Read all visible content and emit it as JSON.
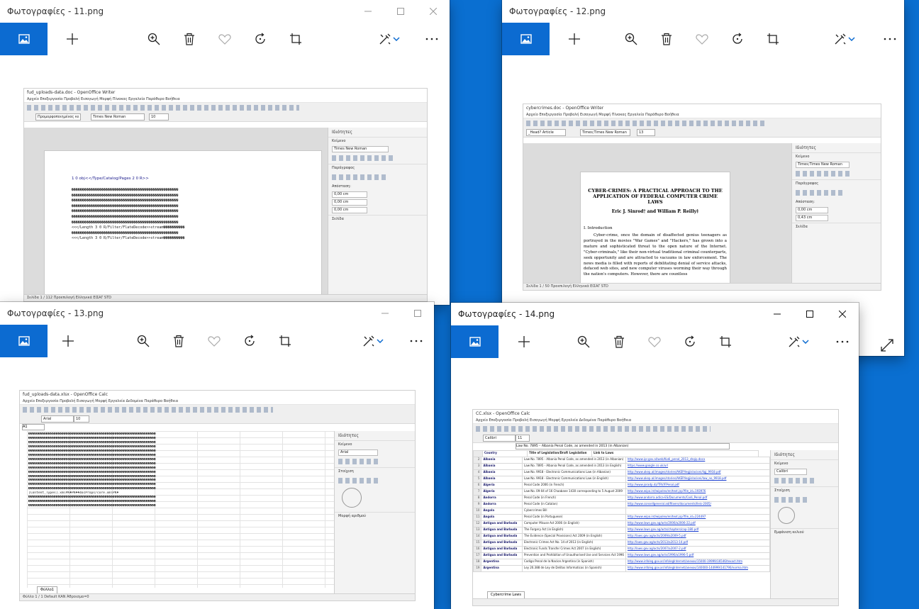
{
  "colors": {
    "desktop": "#0a6fd1",
    "accent": "#0c6bd1"
  },
  "toolbar_icons": [
    "image-icon",
    "add-icon",
    "zoom-icon",
    "delete-icon",
    "favorite-icon",
    "rotate-icon",
    "crop-icon",
    "edit-icon",
    "more-icon"
  ],
  "win11": {
    "title": "Φωτογραφίες - 11.png",
    "doc": {
      "app_title": "fud_uploads-data.doc - OpenOffice Writer",
      "menu": "Αρχείο  Επεξεργασία  Προβολή  Εισαγωγή  Μορφή  Πίνακας  Εργαλεία  Παράθυρο  Βοήθεια",
      "style": "Προμορφοποιημένος κε",
      "font": "Times New Roman",
      "size": "10",
      "sidebar_title": "Ιδιότητες",
      "sec_text": "Κείμενο",
      "sec_para": "Παράγραφος",
      "sec_page": "Σελίδα",
      "spacing": "Απόσταση:",
      "indent": "Εσοχή:",
      "val": "0,00 cm",
      "page_head": "1 0 obj<</Type/Catalog/Pages 2 0 R>>",
      "garble_line": "��������������������������������������������������",
      "garble_mix": "<<</Length 3 0 R/Filter/FlateDecode>>stream����������",
      "status": "Σελίδα 1 / 112    Προεπιλογή    Ελληνικά    ΕΙΣΑΓ    STD"
    }
  },
  "win12": {
    "title": "Φωτογραφίες - 12.png",
    "doc": {
      "app_title": "cybercrimes.doc - OpenOffice Writer",
      "menu": "Αρχείο  Επεξεργασία  Προβολή  Εισαγωγή  Μορφή  Πίνακας  Εργαλεία  Παράθυρο  Βοήθεια",
      "style": "_Head? Article",
      "font": "Times;Times New Roman",
      "size": "13",
      "sidebar_title": "Ιδιότητες",
      "sec_text": "Κείμενο",
      "sec_para": "Παράγραφος",
      "sec_page": "Σελίδα",
      "spacing": "Απόσταση:",
      "indent": "Εσοχή:",
      "val1": "0,00 cm",
      "val2": "0,43 cm",
      "paper_title": "CYBER-CRIMES: A PRACTICAL APPROACH TO THE APPLICATION OF FEDERAL COMPUTER CRIME LAWS",
      "paper_authors": "Eric J. Sinrod† and William P. Reilly‡",
      "section": "I.   Introduction",
      "body": "Cyber-crime, once the domain of disaffected genius teenagers as portrayed in the movies \"War Games\" and \"Hackers,\" has grown into a mature and sophisticated threat to the open nature of the Internet. \"Cyber-criminals,\" like their non-virtual traditional criminal counterparts, seek opportunity and are attracted to vacuums in law enforcement. The news media is filled with reports of debilitating denial of service attacks, defaced web sites, and new computer viruses worming their way through the nation's computers. However, there are countless",
      "status": "Σελίδα 1 / 50    Προεπιλογή    Ελληνικά    ΕΙΣΑΓ    STD"
    }
  },
  "win13": {
    "title": "Φωτογραφίες - 13.png",
    "doc": {
      "app_title": "fud_uploads-data.xlsx - OpenOffice Calc",
      "menu": "Αρχείο  Επεξεργασία  Προβολή  Εισαγωγή  Μορφή  Εργαλεία  Δεδομένα  Παράθυρο  Βοήθεια",
      "font": "Arial",
      "size": "10",
      "cellref": "A1",
      "sidebar_title": "Ιδιότητες",
      "sec_text": "Κείμενο",
      "sec_align": "Στοίχιση",
      "sec_num": "Μορφή αριθμού",
      "content_types": "[Content_Types].xmlPK♦PK♦♦docProps/core.xmlPK♦",
      "sheet_tab": "Φύλλο1",
      "garble_line": "�����������������������������������������������������������������",
      "status": "Φύλλο 1 / 1    Default    ΚΑΝ    Άθροισμα=0"
    }
  },
  "win14": {
    "title": "Φωτογραφίες - 14.png",
    "doc": {
      "app_title": "CC.xlsx - OpenOffice Calc",
      "menu": "Αρχείο  Επεξεργασία  Προβολή  Εισαγωγή  Μορφή  Εργαλεία  Δεδομένα  Παράθυρο  Βοήθεια",
      "font": "Calibri",
      "size": "11",
      "formula": "Law No. 7895 – Albania Penal Code, as amended in 2013 (in Albanian)",
      "sidebar_title": "Ιδιότητες",
      "sec_text": "Κείμενο",
      "sec_align": "Στοίχιση",
      "sec_cell": "Εμφάνιση κελιού",
      "col_country": "Country",
      "col_title": "Title of Legislation/Draft Legislation",
      "col_link": "Link to Laws",
      "sheet_tab": "Cybercrime Laws",
      "rows": [
        {
          "c": "Albania",
          "t": "Law No. 7895 - Albania Penal Code, as amended in 2013 (in Albanian)",
          "l": "http://www.ipr.gov.al/web/Kodi_penal_2013_shqip.docx"
        },
        {
          "c": "Albania",
          "t": "Law No. 7895 - Albania Penal Code, as amended in 2013 (in English)",
          "l": "https://www.google.co.uk/url"
        },
        {
          "c": "Albania",
          "t": "Law No. 9918 - Electronic Communications Law (in Albanian)",
          "l": "http://www.akep.al/images/stories/AKEP/legjislacioni/ligj_9918.pdf"
        },
        {
          "c": "Albania",
          "t": "Law No. 9918 - Electronic Communications Law (in English)",
          "l": "http://www.akep.al/images/stories/AKEP/legjislacioni/law_no_9918.pdf"
        },
        {
          "c": "Algeria",
          "t": "Penal Code 2006 (in French)",
          "l": "http://www.joradp.dz/TRV/FPenal.pdf"
        },
        {
          "c": "Algeria",
          "t": "Law No. 09-04 of 16 Chaabane 1430 corresponding to 5 August 2009",
          "l": "http://www.wipo.int/wipolex/en/text.jsp?file_id=193976"
        },
        {
          "c": "Andorra",
          "t": "Penal Code (in French)",
          "l": "http://www.andorra.ad/ca-ES/Documents/Codi_Penal.pdf"
        },
        {
          "c": "Andorra",
          "t": "Penal Code (in Catalan)",
          "l": "http://www.consellgeneral.ad/fitxers/documents/lleis-2005/"
        },
        {
          "c": "Angola",
          "t": "Cybercrimes Bill",
          "l": ""
        },
        {
          "c": "Angola",
          "t": "Penal Code (in Portuguese)",
          "l": "http://www.wipo.int/wipolex/en/text.jsp?file_id=224497"
        },
        {
          "c": "Antigua and Barbuda",
          "t": "Computer Misuse Act 2006 (in English)",
          "l": "http://www.laws.gov.ag/acts/2006/a2006-22.pdf"
        },
        {
          "c": "Antigua and Barbuda",
          "t": "The Forgery Act (in English)",
          "l": "http://www.laws.gov.ag/acts/chapters/cap-180.pdf"
        },
        {
          "c": "Antigua and Barbuda",
          "t": "The Evidence (Special Provisions) Act 2009 (in English)",
          "l": "http://laws.gov.ag/acts/2009/a2009-5.pdf"
        },
        {
          "c": "Antigua and Barbuda",
          "t": "Electronic Crimes Act No. 14 of 2013 (in English)",
          "l": "http://laws.gov.ag/acts/2013/a2013-14.pdf"
        },
        {
          "c": "Antigua and Barbuda",
          "t": "Electronic Funds Transfer Crimes Act 2007 (in English)",
          "l": "http://laws.gov.ag/acts/2007/a2007-2.pdf"
        },
        {
          "c": "Antigua and Barbuda",
          "t": "Prevention and Prohibition of Unauthorised Use and Services Act 1996",
          "l": "http://www.laws.gov.ag/acts/1996/a1996-5.pdf"
        },
        {
          "c": "Argentina",
          "t": "Codigo Penal de la Nacion Argentina (in Spanish)",
          "l": "http://www.infoleg.gov.ar/infolegInternet/anexos/15000-19999/16546/texact.htm"
        },
        {
          "c": "Argentina",
          "t": "Ley 26.388 de Ley de Delitos Informaticos (in Spanish)",
          "l": "http://www.infoleg.gov.ar/infolegInternet/anexos/140000-144999/141790/norma.htm"
        }
      ]
    }
  }
}
